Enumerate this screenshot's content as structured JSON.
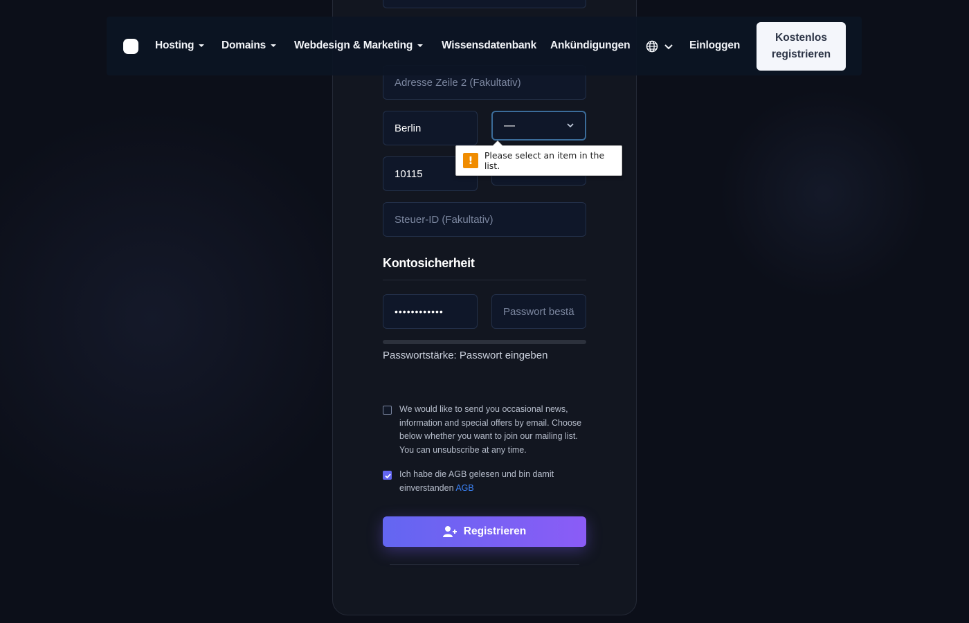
{
  "nav": {
    "items": [
      {
        "label": "Hosting",
        "caret": true
      },
      {
        "label": "Domains",
        "caret": true
      },
      {
        "label": "Webdesign & Marketing",
        "caret": true
      },
      {
        "label": "Wissensdatenbank",
        "caret": false
      },
      {
        "label": "Ankündigungen",
        "caret": false
      }
    ],
    "language_icon": "globe-icon",
    "login_label": "Einloggen",
    "register_label": "Kostenlos registrieren"
  },
  "form": {
    "address2_placeholder": "Adresse Zeile 2 (Fakultativ)",
    "city_value": "Berlin",
    "state_value": "—",
    "zip_value": "10115",
    "tax_id_placeholder": "Steuer-ID (Fakultativ)",
    "validation_tooltip": "Please select an item in the list.",
    "security_heading": "Kontosicherheit",
    "password_value": "••••••••••••",
    "password_confirm_placeholder": "Passwort bestä",
    "strength_text": "Passwortstärke: Passwort eingeben",
    "newsletter_text": "We would like to send you occasional news, information and special offers by email. Choose below whether you want to join our mailing list. You can unsubscribe at any time.",
    "newsletter_checked": false,
    "agb_text": "Ich habe die AGB gelesen und bin damit einverstanden",
    "agb_link": "AGB",
    "agb_checked": true,
    "submit_label": "Registrieren"
  },
  "colors": {
    "background": "#0c0f19",
    "accent_start": "#6366f1",
    "accent_end": "#8b5cf6",
    "link": "#3b82f6",
    "warning": "#f08c00"
  }
}
